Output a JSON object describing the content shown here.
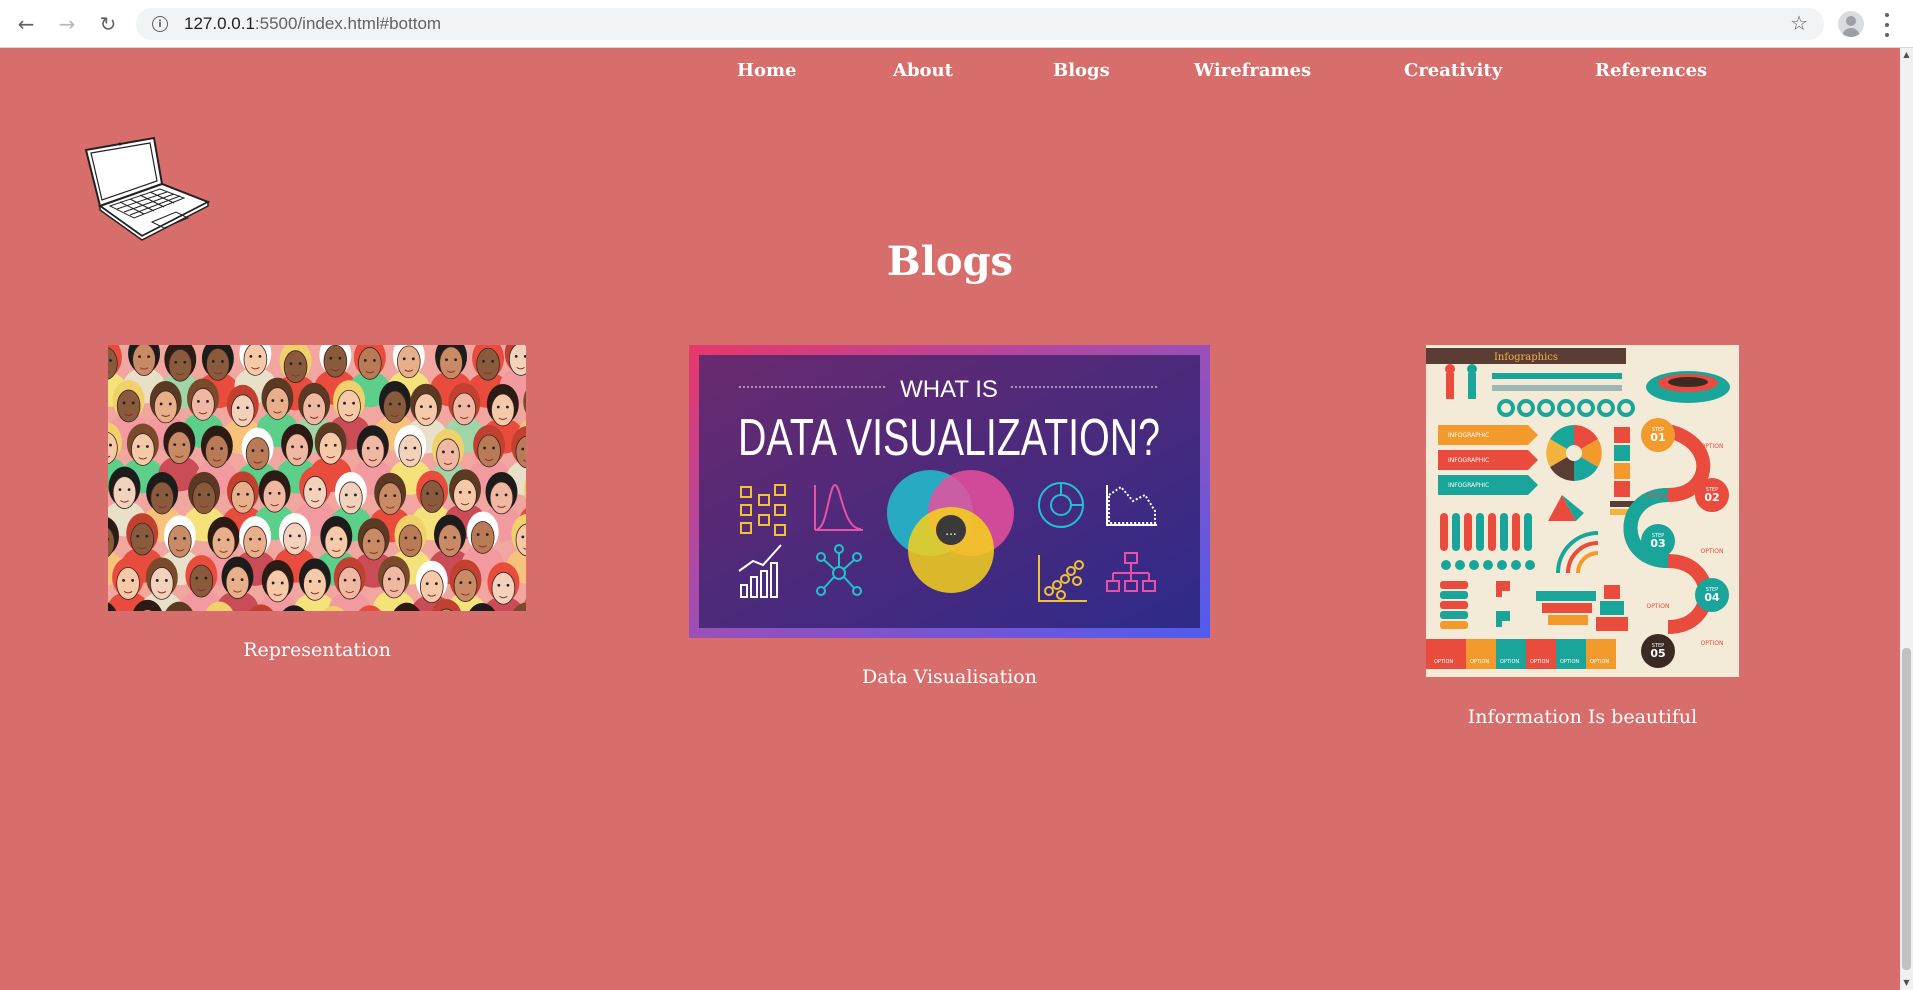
{
  "browser": {
    "back_icon": "←",
    "forward_icon": "→",
    "reload_icon": "↻",
    "url_host": "127.0.0.1",
    "url_rest": ":5500/index.html#bottom",
    "star_icon": "☆"
  },
  "nav": {
    "items": [
      {
        "label": "Home"
      },
      {
        "label": "About"
      },
      {
        "label": "Blogs"
      },
      {
        "label": "Wireframes"
      },
      {
        "label": "Creativity"
      },
      {
        "label": "References"
      }
    ]
  },
  "section": {
    "title": "Blogs"
  },
  "blogs": [
    {
      "caption": "Representation"
    },
    {
      "caption": "Data Visualisation",
      "image_text": {
        "top": "WHAT IS",
        "main": "DATA VISUALIZATION?"
      }
    },
    {
      "caption": "Information Is beautiful",
      "image_text": {
        "banner": "Infographics",
        "steps": [
          "STEP 01",
          "STEP 02",
          "STEP 03",
          "STEP 04",
          "STEP 05"
        ],
        "step_labels": [
          "STEP",
          "STEP",
          "STEP",
          "STEP",
          "STEP"
        ],
        "step_numbers": [
          "01",
          "02",
          "03",
          "04",
          "05"
        ],
        "option_label": "OPTION",
        "infographic_label": "INFOGRAPHIC"
      }
    }
  ],
  "colors": {
    "page_background": "#d76e6c",
    "nav_text": "#ffffff",
    "dataviz_gradient_start": "#e8386a",
    "dataviz_gradient_end": "#4e5cf0"
  }
}
